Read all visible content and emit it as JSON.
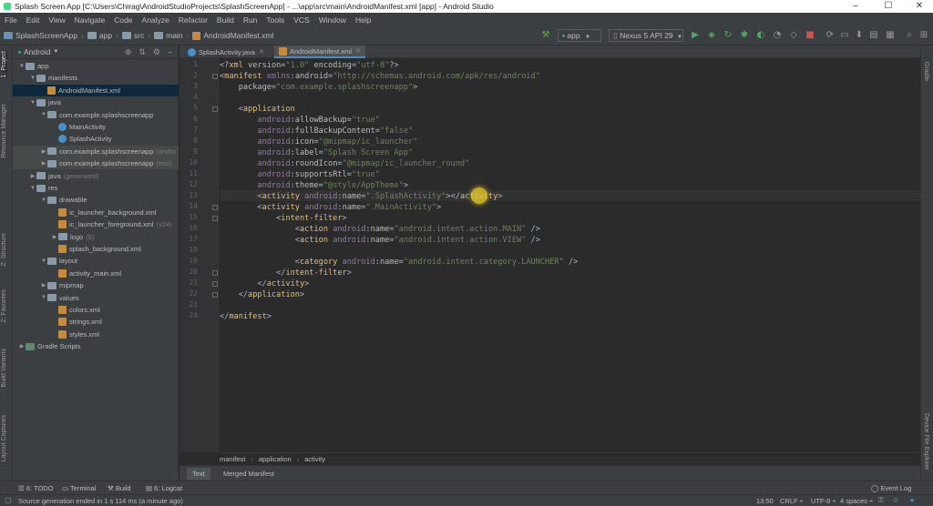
{
  "window": {
    "title": "Splash Screen App [C:\\Users\\Chirag\\AndroidStudioProjects\\SplashScreenApp] - ...\\app\\src\\main\\AndroidManifest.xml [app] - Android Studio",
    "minimize": "–",
    "maximize": "☐",
    "close": "✕"
  },
  "menu": [
    "File",
    "Edit",
    "View",
    "Navigate",
    "Code",
    "Analyze",
    "Refactor",
    "Build",
    "Run",
    "Tools",
    "VCS",
    "Window",
    "Help"
  ],
  "breadcrumb": [
    "SplashScreenApp",
    "app",
    "src",
    "main",
    "AndroidManifest.xml"
  ],
  "toolbar": {
    "run_config": "app",
    "device": "Nexus 5 API 29",
    "icons": [
      "hammer-icon",
      "run-icon",
      "debug-icon",
      "profile-icon",
      "sync-icon",
      "avd-manager-icon",
      "sdk-manager-icon",
      "search-icon"
    ]
  },
  "left_strip": {
    "project": "1: Project",
    "resource_manager": "Resource Manager",
    "structure": "Z: Structure",
    "favorites": "2: Favorites",
    "build_variants": "Build Variants",
    "layout_captures": "Layout Captures"
  },
  "right_strip": {
    "gradle": "Gradle",
    "device_file_explorer": "Device File Explorer"
  },
  "project_panel": {
    "view": "Android",
    "tree": [
      {
        "label": "app",
        "indent": 0,
        "arrow": "▼",
        "icon": "folder",
        "tag": ""
      },
      {
        "label": "manifests",
        "indent": 1,
        "arrow": "▼",
        "icon": "folder",
        "tag": ""
      },
      {
        "label": "AndroidManifest.xml",
        "indent": 2,
        "arrow": "",
        "icon": "xml",
        "tag": ""
      },
      {
        "label": "java",
        "indent": 1,
        "arrow": "▼",
        "icon": "folder",
        "tag": ""
      },
      {
        "label": "com.example.splashscreenapp",
        "indent": 2,
        "arrow": "▼",
        "icon": "folder",
        "tag": ""
      },
      {
        "label": "MainActivity",
        "indent": 3,
        "arrow": "",
        "icon": "java",
        "tag": ""
      },
      {
        "label": "SplashActivity",
        "indent": 3,
        "arrow": "",
        "icon": "java",
        "tag": ""
      },
      {
        "label": "com.example.splashscreenapp",
        "indent": 2,
        "arrow": "▶",
        "icon": "folder",
        "tag": "(andro"
      },
      {
        "label": "com.example.splashscreenapp",
        "indent": 2,
        "arrow": "▶",
        "icon": "folder",
        "tag": "(test)"
      },
      {
        "label": "java",
        "indent": 1,
        "arrow": "▶",
        "icon": "folder",
        "tag": "(generated)"
      },
      {
        "label": "res",
        "indent": 1,
        "arrow": "▼",
        "icon": "folder",
        "tag": ""
      },
      {
        "label": "drawable",
        "indent": 2,
        "arrow": "▼",
        "icon": "folder",
        "tag": ""
      },
      {
        "label": "ic_launcher_background.xml",
        "indent": 3,
        "arrow": "",
        "icon": "xml",
        "tag": ""
      },
      {
        "label": "ic_launcher_foreground.xml",
        "indent": 3,
        "arrow": "",
        "icon": "xml",
        "tag": "(v24)"
      },
      {
        "label": "logo",
        "indent": 3,
        "arrow": "▶",
        "icon": "folder",
        "tag": "(6)"
      },
      {
        "label": "splash_background.xml",
        "indent": 3,
        "arrow": "",
        "icon": "xml",
        "tag": ""
      },
      {
        "label": "layout",
        "indent": 2,
        "arrow": "▼",
        "icon": "folder",
        "tag": ""
      },
      {
        "label": "activity_main.xml",
        "indent": 3,
        "arrow": "",
        "icon": "xml",
        "tag": ""
      },
      {
        "label": "mipmap",
        "indent": 2,
        "arrow": "▶",
        "icon": "folder",
        "tag": ""
      },
      {
        "label": "values",
        "indent": 2,
        "arrow": "▼",
        "icon": "folder",
        "tag": ""
      },
      {
        "label": "colors.xml",
        "indent": 3,
        "arrow": "",
        "icon": "xml",
        "tag": ""
      },
      {
        "label": "strings.xml",
        "indent": 3,
        "arrow": "",
        "icon": "xml",
        "tag": ""
      },
      {
        "label": "styles.xml",
        "indent": 3,
        "arrow": "",
        "icon": "xml",
        "tag": ""
      },
      {
        "label": "Gradle Scripts",
        "indent": 0,
        "arrow": "▶",
        "icon": "gradle",
        "tag": ""
      }
    ]
  },
  "editor_tabs": [
    {
      "label": "SplashActivity.java",
      "icon": "java"
    },
    {
      "label": "AndroidManifest.xml",
      "icon": "xml"
    }
  ],
  "code_lines": [
    "<?xml version=\"1.0\" encoding=\"utf-8\"?>",
    "<manifest xmlns:android=\"http://schemas.android.com/apk/res/android\"",
    "    package=\"com.example.splashscreenapp\">",
    "",
    "    <application",
    "        android:allowBackup=\"true\"",
    "        android:fullBackupContent=\"false\"",
    "        android:icon=\"@mipmap/ic_launcher\"",
    "        android:label=\"Splash Screen App\"",
    "        android:roundIcon=\"@mipmap/ic_launcher_round\"",
    "        android:supportsRtl=\"true\"",
    "        android:theme=\"@style/AppTheme\">",
    "        <activity android:name=\".SplashActivity\"></activity>",
    "        <activity android:name=\".MainActivity\">",
    "            <intent-filter>",
    "                <action android:name=\"android.intent.action.MAIN\" />",
    "                <action android:name=\"android.intent.action.VIEW\" />",
    "",
    "                <category android:name=\"android.intent.category.LAUNCHER\" />",
    "            </intent-filter>",
    "        </activity>",
    "    </application>",
    "",
    "</manifest>"
  ],
  "editor_breadcrumb": [
    "manifest",
    "application",
    "activity"
  ],
  "bottom_editor_tabs": [
    "Text",
    "Merged Manifest"
  ],
  "tool_windows": [
    "6: TODO",
    "Terminal",
    "Build",
    "6: Logcat"
  ],
  "event_log": "Event Log",
  "status": {
    "message": "Source generation ended in 1 s 114 ms (a minute ago)",
    "position": "13:50",
    "line_sep": "CRLF ÷",
    "encoding": "UTF-8 ÷",
    "indent": "4 spaces ÷"
  }
}
